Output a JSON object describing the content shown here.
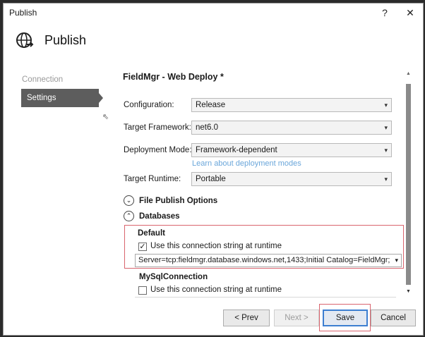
{
  "window": {
    "title": "Publish",
    "help_glyph": "?",
    "close_glyph": "✕"
  },
  "header": {
    "title": "Publish",
    "icon": "globe-publish-icon"
  },
  "nav": {
    "items": [
      {
        "label": "Connection",
        "state": "disabled"
      },
      {
        "label": "Settings",
        "state": "selected"
      }
    ]
  },
  "settings": {
    "profile_name": "FieldMgr - Web Deploy *",
    "configuration": {
      "label": "Configuration:",
      "value": "Release"
    },
    "target_framework": {
      "label": "Target Framework:",
      "value": "net6.0"
    },
    "deployment_mode": {
      "label": "Deployment Mode:",
      "value": "Framework-dependent"
    },
    "learn_link": "Learn about deployment modes",
    "target_runtime": {
      "label": "Target Runtime:",
      "value": "Portable"
    }
  },
  "sections": {
    "file_publish": {
      "label": "File Publish Options",
      "expanded": false
    },
    "databases": {
      "label": "Databases",
      "expanded": true
    }
  },
  "databases": {
    "default": {
      "title": "Default",
      "checkbox_label": "Use this connection string at runtime",
      "checked": true,
      "connection_string": "Server=tcp:fieldmgr.database.windows.net,1433;Initial Catalog=FieldMgr;Persist S"
    },
    "mysql": {
      "title": "MySqlConnection",
      "checkbox_label": "Use this connection string at runtime",
      "checked": false
    }
  },
  "footer": {
    "prev_label": "< Prev",
    "next_label": "Next >",
    "save_label": "Save",
    "cancel_label": "Cancel"
  },
  "colors": {
    "highlight": "#d9646e",
    "selected_nav": "#5d5d5d",
    "link": "#6aa6da",
    "focus": "#3d7fd1"
  }
}
